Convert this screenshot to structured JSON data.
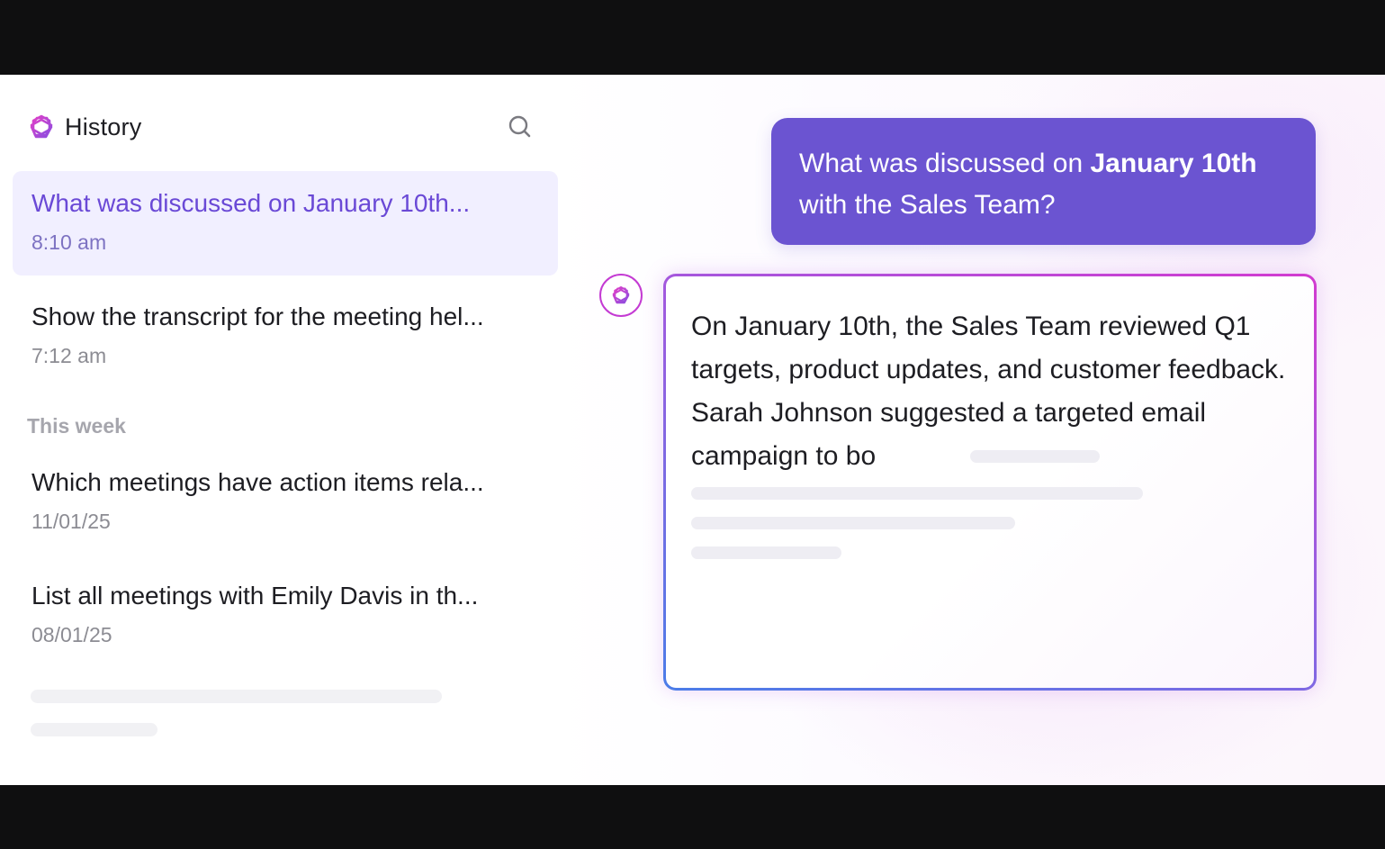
{
  "sidebar": {
    "title": "History",
    "search_icon": "search-icon",
    "brand_icon": "openai-knot-icon",
    "recent": [
      {
        "title": "What was discussed on January 10th...",
        "time": "8:10 am",
        "active": true
      },
      {
        "title": "Show the transcript for the meeting hel...",
        "time": "7:12 am",
        "active": false
      }
    ],
    "section_label": "This week",
    "this_week": [
      {
        "title": "Which meetings have action items rela...",
        "time": "11/01/25"
      },
      {
        "title": "List all meetings with Emily Davis in th...",
        "time": "08/01/25"
      }
    ]
  },
  "chat": {
    "user_message": {
      "prefix": "What was discussed on ",
      "bold": "January 10th",
      "suffix": " with the Sales Team?"
    },
    "ai_response": "On January 10th, the Sales Team reviewed Q1 targets, product updates, and customer feedback. Sarah Johnson suggested a targeted email campaign to bo",
    "ai_avatar_icon": "openai-knot-icon"
  },
  "colors": {
    "accent": "#6b54d1",
    "active_item_bg": "#f1efff",
    "active_item_text": "#6a49d6",
    "brand_gradient_start": "#d23ad0",
    "brand_gradient_end": "#4b7de8"
  }
}
